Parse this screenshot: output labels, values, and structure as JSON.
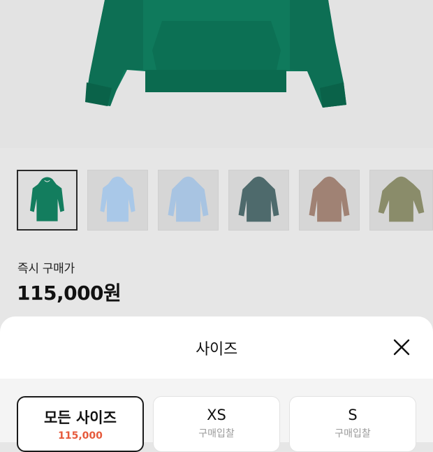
{
  "product": {
    "main_image": {
      "icon": "green-hoodie-image",
      "color": "#0f7a5c"
    },
    "thumbnails": [
      {
        "name": "thumbnail-green-hoodie",
        "color": "#137d5e",
        "selected": true
      },
      {
        "name": "thumbnail-light-blue-hoodie",
        "color": "#a9c8e8",
        "selected": false
      },
      {
        "name": "thumbnail-sky-blue-hoodie",
        "color": "#a8c4e2",
        "selected": false
      },
      {
        "name": "thumbnail-slate-hoodie",
        "color": "#4e6a6c",
        "selected": false
      },
      {
        "name": "thumbnail-mauve-hoodie",
        "color": "#a08274",
        "selected": false
      },
      {
        "name": "thumbnail-olive-hoodie",
        "color": "#8a8c6a",
        "selected": false
      }
    ],
    "price_label": "즉시 구매가",
    "price_value": "115,000원"
  },
  "size_sheet": {
    "title": "사이즈",
    "close_icon": "close-icon",
    "options": [
      {
        "label": "모든 사이즈",
        "sub": "115,000",
        "selected": true
      },
      {
        "label": "XS",
        "sub": "구매입찰",
        "selected": false
      },
      {
        "label": "S",
        "sub": "구매입찰",
        "selected": false
      }
    ]
  },
  "colors": {
    "accent_price": "#e65a3c",
    "selected_border": "#1a1a1a"
  }
}
